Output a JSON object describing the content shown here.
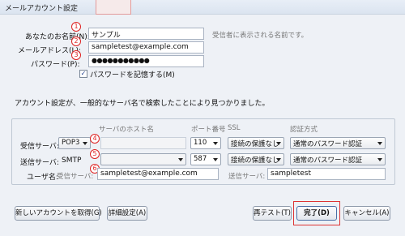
{
  "window": {
    "title": "メールアカウント設定"
  },
  "form": {
    "name_label": "あなたのお名前(N):",
    "name_value": "サンプル",
    "name_hint": "受信者に表示される名前です。",
    "email_label": "メールアドレス(L):",
    "email_value": "sampletest@example.com",
    "password_label": "パスワード(P):",
    "password_value": "●●●●●●●●●●●",
    "remember_label": "パスワードを記憶する(M)",
    "remember_check": "✓",
    "info_text": "アカウント設定が、一般的なサーバ名で検索したことにより見つかりました。"
  },
  "steps": [
    "1",
    "2",
    "3",
    "4",
    "5",
    "6"
  ],
  "server": {
    "col_host": "サーバのホスト名",
    "col_port": "ポート番号",
    "col_ssl": "SSL",
    "col_auth": "認証方式",
    "incoming_label": "受信サーバ:",
    "incoming_protocol": "POP3",
    "incoming_port": "110",
    "incoming_ssl": "接続の保護なし",
    "incoming_auth": "通常のパスワード認証",
    "outgoing_label": "送信サーバ:",
    "outgoing_protocol": "SMTP",
    "outgoing_port": "587",
    "outgoing_ssl": "接続の保護なし",
    "outgoing_auth": "通常のパスワード認証",
    "username_label": "ユーザ名:",
    "incoming_user_label": "受信サーバ:",
    "incoming_user_value": "sampletest@example.com",
    "outgoing_user_label": "送信サーバ:",
    "outgoing_user_value": "sampletest"
  },
  "buttons": {
    "new_account": "新しいアカウントを取得(G)",
    "advanced": "詳細設定(A)",
    "retest": "再テスト(T)",
    "done": "完了(D)",
    "cancel": "キャンセル(A)"
  },
  "colors": {
    "accent_red": "#d33333",
    "window_bg": "#eef1f6"
  }
}
